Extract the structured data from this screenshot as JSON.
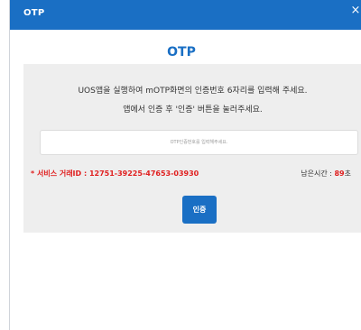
{
  "dialog": {
    "header_title": "OTP",
    "close_label": "×",
    "main_title": "OTP"
  },
  "instructions": {
    "line1": "UOS앱을 실행하여 mOTP화면의 인증번호 6자리를 입력해 주세요.",
    "line2": "앱에서 인증 후 '인증' 버튼을 눌러주세요."
  },
  "otp_input": {
    "value": "",
    "placeholder": "OTP인증번호를 입력해주세요."
  },
  "transaction": {
    "label": "* 서비스 거래ID : ",
    "id": "12751-39225-47653-03930"
  },
  "timer": {
    "label": "남은시간 : ",
    "seconds": "89",
    "unit": "초"
  },
  "actions": {
    "auth_label": "인증"
  },
  "colors": {
    "primary": "#1a6fc4",
    "alert": "#e02020",
    "panel_bg": "#eeeeee"
  }
}
